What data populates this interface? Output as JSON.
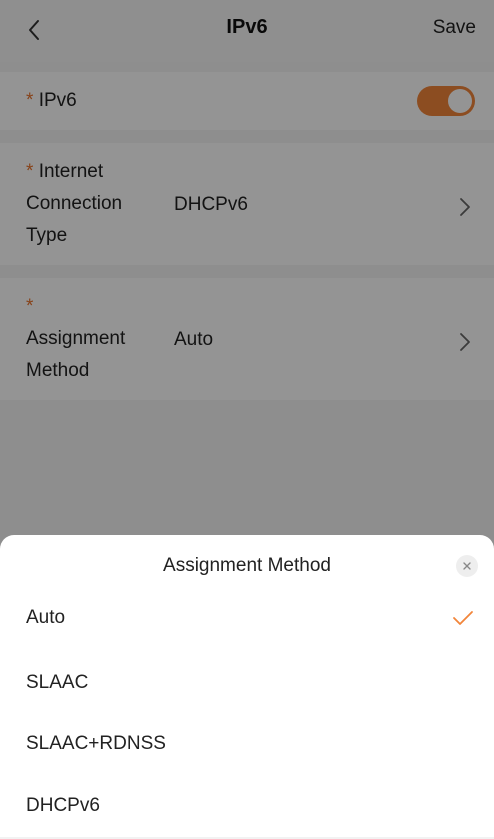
{
  "header": {
    "title": "IPv6",
    "save_label": "Save",
    "back_icon": "chevron-left-icon"
  },
  "settings": {
    "ipv6": {
      "required_mark": "*",
      "label": "IPv6",
      "enabled": true,
      "toggle_color": "#f2853a"
    },
    "connection_type": {
      "required_mark": "*",
      "label_lines": [
        "Internet",
        "Connection",
        "Type"
      ],
      "value": "DHCPv6",
      "chevron_icon": "chevron-right-icon"
    },
    "assignment_method": {
      "required_mark": "*",
      "label_lines": [
        "Assignment",
        "Method"
      ],
      "value": "Auto",
      "chevron_icon": "chevron-right-icon"
    }
  },
  "sheet": {
    "title": "Assignment Method",
    "close_icon": "close-icon",
    "options": [
      {
        "label": "Auto",
        "selected": true
      },
      {
        "label": "SLAAC",
        "selected": false
      },
      {
        "label": "SLAAC+RDNSS",
        "selected": false
      },
      {
        "label": "DHCPv6",
        "selected": false
      }
    ],
    "check_icon": "checkmark-icon",
    "accent_color": "#f2853a"
  }
}
